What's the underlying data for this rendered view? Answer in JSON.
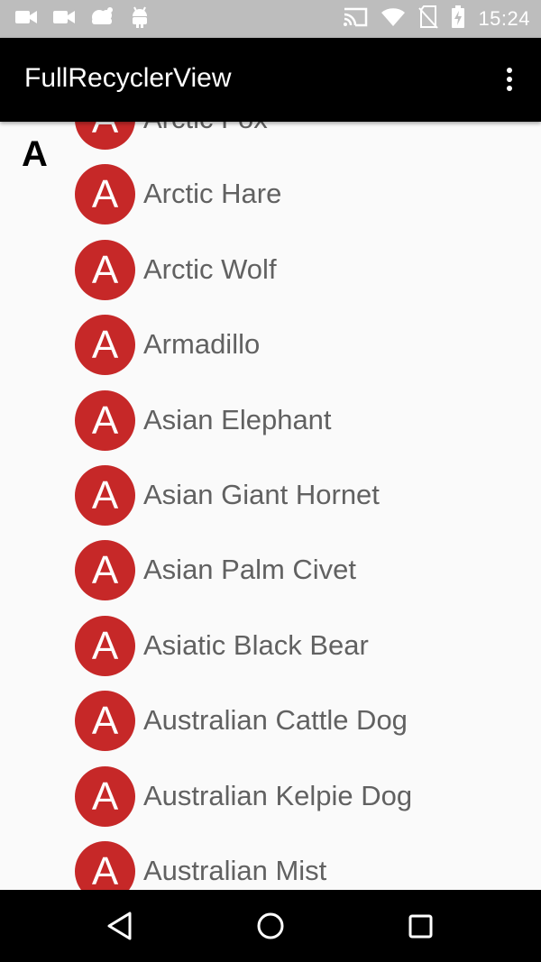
{
  "status_bar": {
    "left_icons": [
      "video-camera-icon",
      "video-camera-icon",
      "weather-icon",
      "android-icon"
    ],
    "right_icons": [
      "cast-icon",
      "wifi-icon",
      "no-sim-icon",
      "battery-charging-icon"
    ],
    "time": "15:24"
  },
  "app_bar": {
    "title": "FullRecyclerView",
    "menu_icon": "overflow-menu-icon"
  },
  "list": {
    "section_header": "A",
    "avatar_color": "#c62828",
    "items": [
      {
        "letter": "A",
        "label": "Arctic Fox"
      },
      {
        "letter": "A",
        "label": "Arctic Hare"
      },
      {
        "letter": "A",
        "label": "Arctic Wolf"
      },
      {
        "letter": "A",
        "label": "Armadillo"
      },
      {
        "letter": "A",
        "label": "Asian Elephant"
      },
      {
        "letter": "A",
        "label": "Asian Giant Hornet"
      },
      {
        "letter": "A",
        "label": "Asian Palm Civet"
      },
      {
        "letter": "A",
        "label": "Asiatic Black Bear"
      },
      {
        "letter": "A",
        "label": "Australian Cattle Dog"
      },
      {
        "letter": "A",
        "label": "Australian Kelpie Dog"
      },
      {
        "letter": "A",
        "label": "Australian Mist"
      }
    ]
  },
  "nav_bar": {
    "buttons": [
      "back-icon",
      "home-icon",
      "recents-icon"
    ]
  }
}
